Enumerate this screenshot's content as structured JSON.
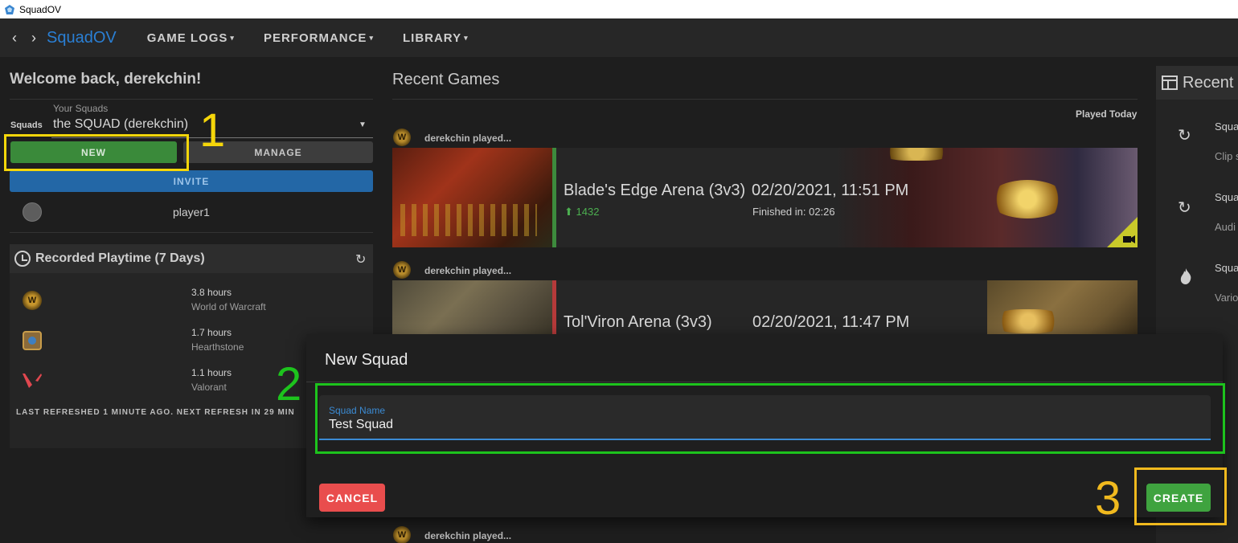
{
  "window": {
    "title": "SquadOV"
  },
  "nav": {
    "brand": "SquadOV",
    "menus": [
      {
        "label": "GAME LOGS"
      },
      {
        "label": "PERFORMANCE"
      },
      {
        "label": "LIBRARY"
      }
    ]
  },
  "welcome": "Welcome back, derekchin!",
  "squads": {
    "row_label": "Squads",
    "select_label": "Your Squads",
    "selected": "the SQUAD (derekchin)",
    "new_label": "NEW",
    "manage_label": "MANAGE",
    "invite_label": "INVITE",
    "members": [
      {
        "name": "player1"
      }
    ]
  },
  "playtime": {
    "title": "Recorded Playtime (7 Days)",
    "entries": [
      {
        "hours": "3.8 hours",
        "game": "World of Warcraft",
        "icon": "wow-icon"
      },
      {
        "hours": "1.7 hours",
        "game": "Hearthstone",
        "icon": "hearthstone-icon"
      },
      {
        "hours": "1.1 hours",
        "game": "Valorant",
        "icon": "valorant-icon"
      }
    ],
    "refreshed": "LAST REFRESHED 1 MINUTE AGO. NEXT REFRESH IN 29 MIN"
  },
  "recent_games": {
    "title": "Recent Games",
    "group_label": "Played Today",
    "games": [
      {
        "played_by": "derekchin played...",
        "arena": "Blade's Edge Arena (3v3)",
        "rating": "1432",
        "date": "02/20/2021, 11:51 PM",
        "finished": "Finished in: 02:26",
        "result_color": "#3d8b3d"
      },
      {
        "played_by": "derekchin played...",
        "arena": "Tol'Viron Arena (3v3)",
        "date": "02/20/2021, 11:47 PM",
        "result_color": "#b53a3a"
      },
      {
        "played_by": "derekchin played..."
      }
    ]
  },
  "right_panel": {
    "title": "Recent",
    "items": [
      {
        "icon": "replay-icon",
        "line1": "Squa",
        "line2": "Clip s"
      },
      {
        "icon": "replay-icon",
        "line1": "Squa",
        "line2": "Audi"
      },
      {
        "icon": "fire-icon",
        "line1": "Squa",
        "line2": "Vario"
      }
    ]
  },
  "dialog": {
    "title": "New Squad",
    "field_label": "Squad Name",
    "field_value": "Test Squad",
    "cancel_label": "CANCEL",
    "create_label": "CREATE"
  },
  "annotations": {
    "step1": "1",
    "step2": "2",
    "step3": "3",
    "colors": {
      "yellow": "#f5d60a",
      "green": "#1dc31d",
      "orange": "#f0b91e"
    }
  },
  "colors": {
    "accent": "#2a7fd4",
    "new_btn": "#3a8a3a",
    "invite_btn": "#2367a6",
    "cancel": "#e94d4d",
    "create": "#3fa33f"
  }
}
